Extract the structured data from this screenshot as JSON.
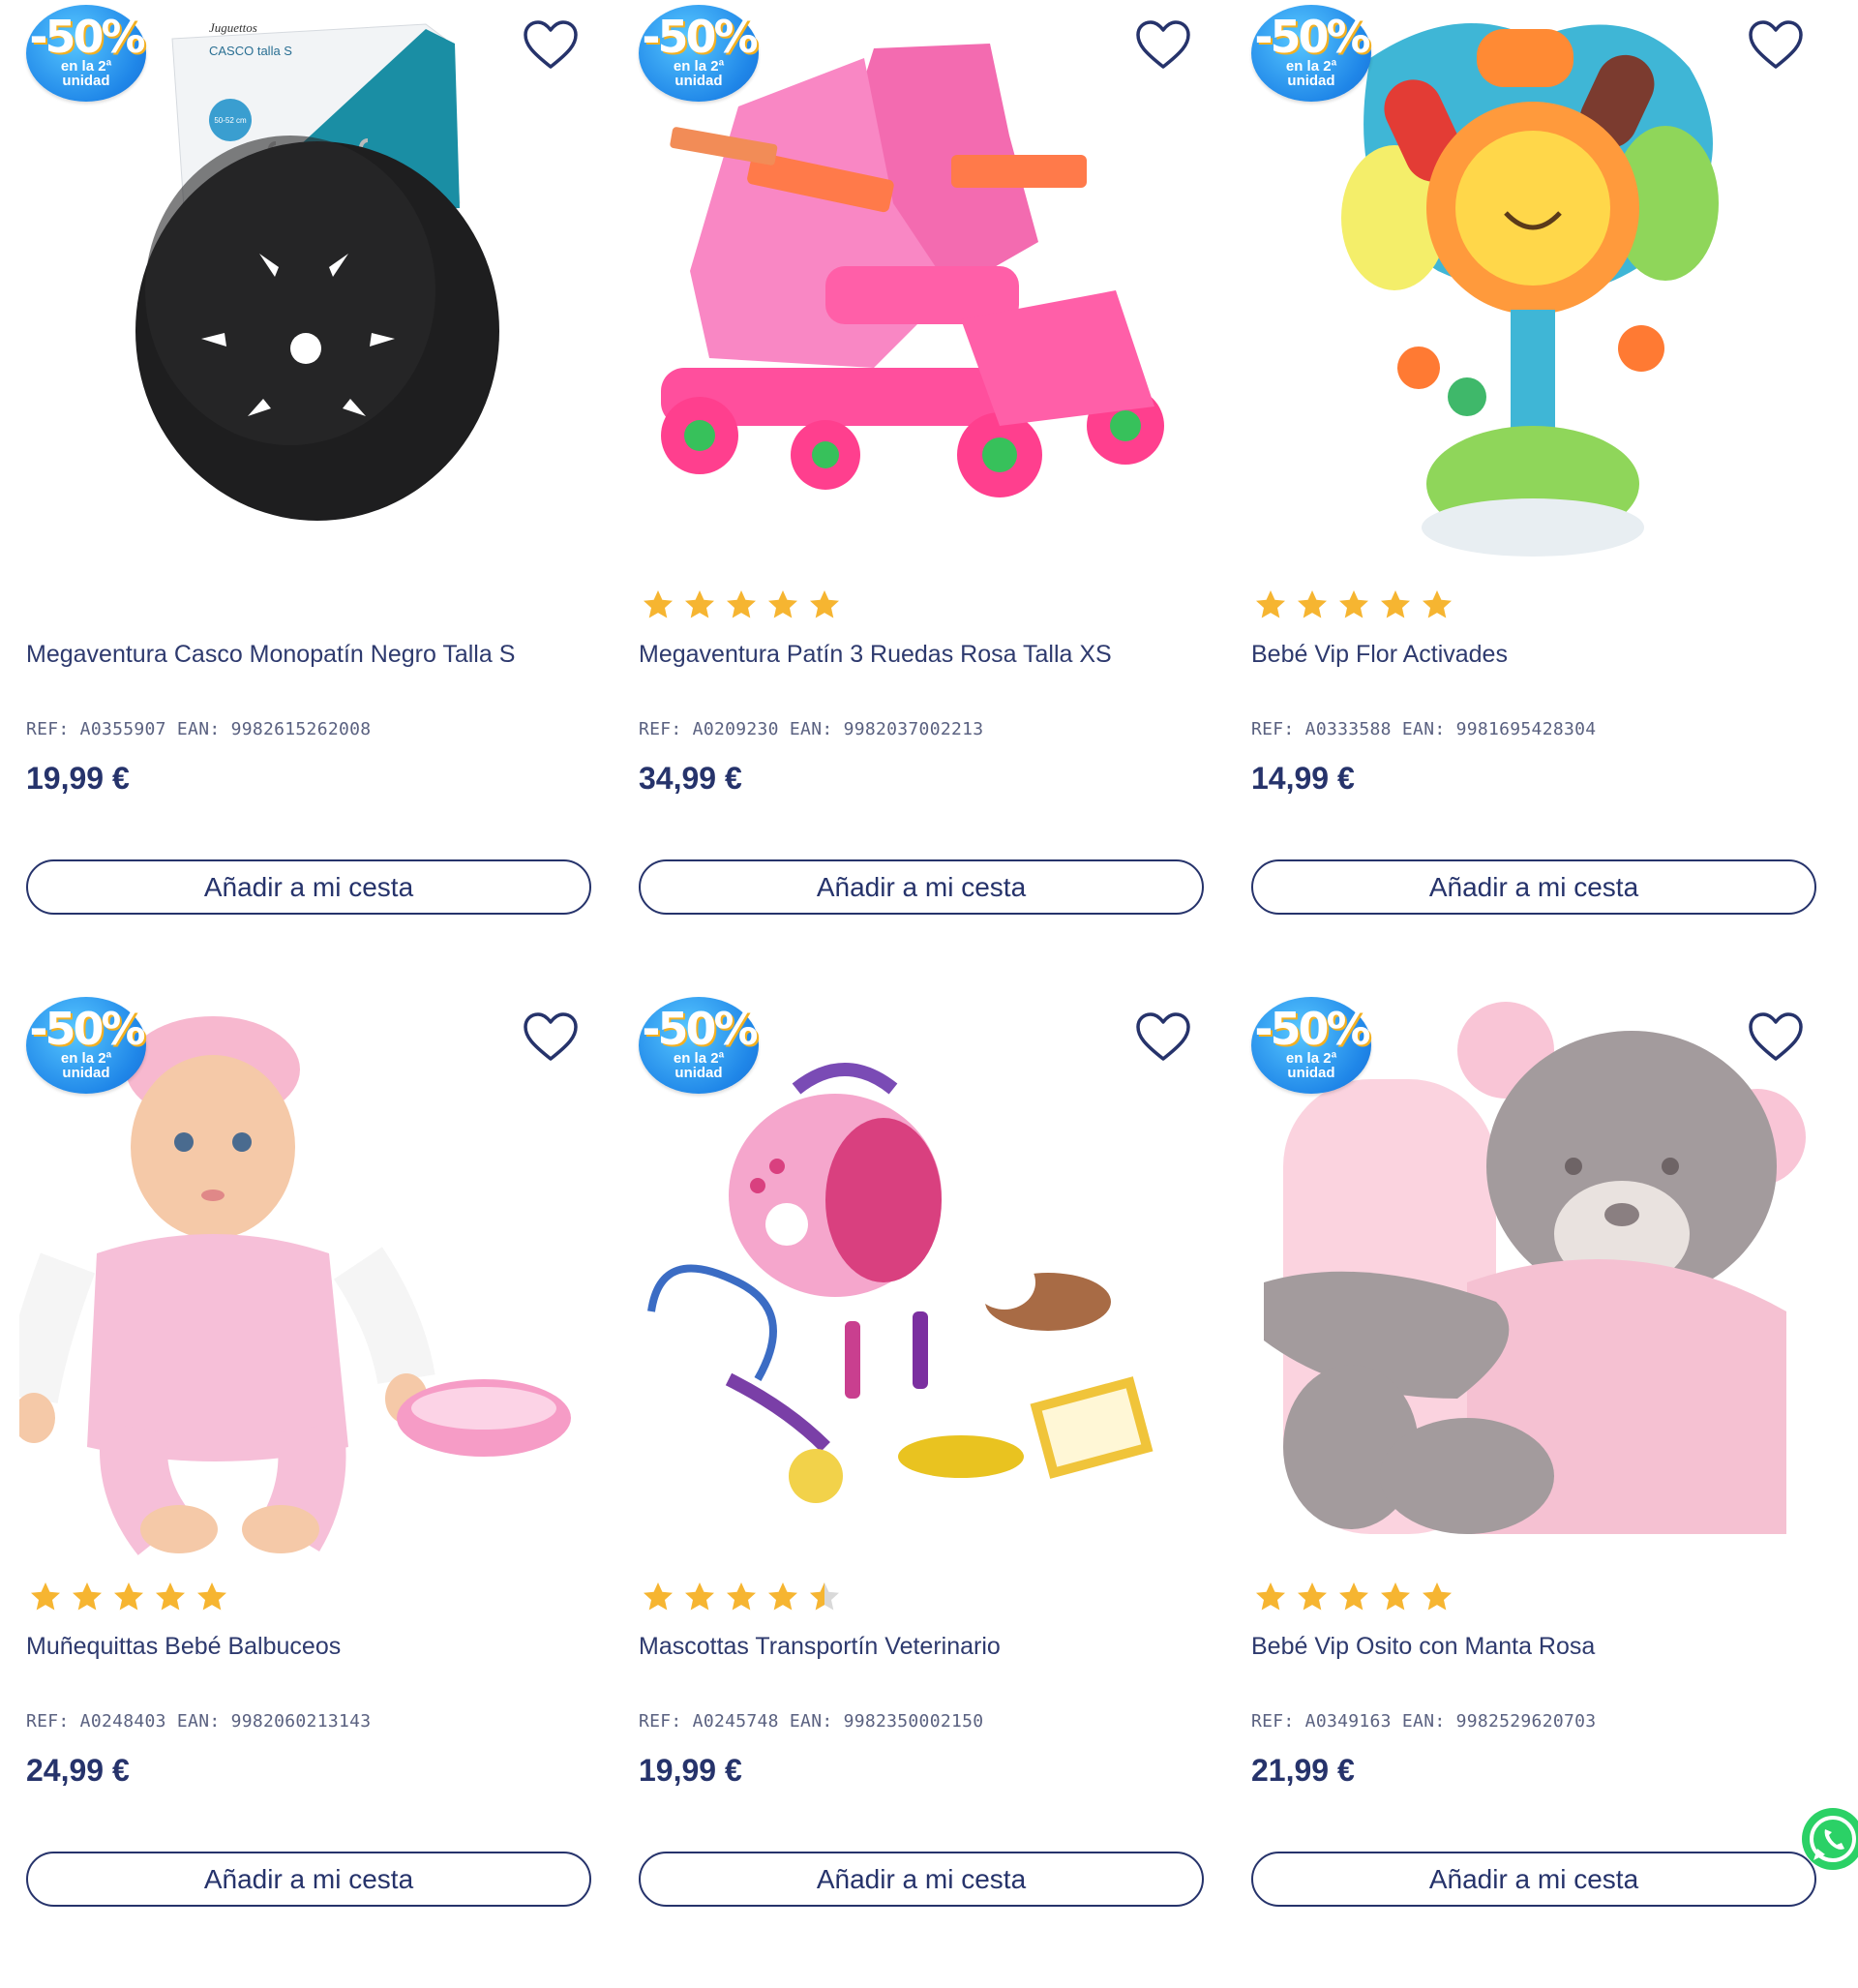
{
  "products": [
    {
      "badge": {
        "discount": "-50%",
        "line1": "en la 2ª",
        "line2": "unidad"
      },
      "image": "helmet-image",
      "rating": null,
      "title": "Megaventura Casco Monopatín Negro Talla S",
      "ref": "REF: A0355907 EAN: 9982615262008",
      "price": "19,99 €",
      "add_label": "Añadir a mi cesta",
      "package_text": [
        "Juguettos",
        "CASCO talla S",
        "50-52 cm"
      ]
    },
    {
      "badge": {
        "discount": "-50%",
        "line1": "en la 2ª",
        "line2": "unidad"
      },
      "image": "roller-skates-image",
      "rating": 5,
      "title": "Megaventura Patín 3 Ruedas Rosa Talla XS",
      "ref": "REF: A0209230 EAN: 9982037002213",
      "price": "34,99 €",
      "add_label": "Añadir a mi cesta"
    },
    {
      "badge": {
        "discount": "-50%",
        "line1": "en la 2ª",
        "line2": "unidad"
      },
      "image": "flower-activity-toy-image",
      "rating": 5,
      "title": "Bebé Vip Flor Activades",
      "ref": "REF: A0333588 EAN: 9981695428304",
      "price": "14,99 €",
      "add_label": "Añadir a mi cesta"
    },
    {
      "badge": {
        "discount": "-50%",
        "line1": "en la 2ª",
        "line2": "unidad"
      },
      "image": "baby-doll-image",
      "rating": 5,
      "title": "Muñequittas Bebé Balbuceos",
      "ref": "REF: A0248403 EAN: 9982060213143",
      "price": "24,99 €",
      "add_label": "Añadir a mi cesta"
    },
    {
      "badge": {
        "discount": "-50%",
        "line1": "en la 2ª",
        "line2": "unidad"
      },
      "image": "vet-carrier-set-image",
      "rating": 4.5,
      "title": "Mascottas Transportín Veterinario",
      "ref": "REF: A0245748 EAN: 9982350002150",
      "price": "19,99 €",
      "add_label": "Añadir a mi cesta"
    },
    {
      "badge": {
        "discount": "-50%",
        "line1": "en la 2ª",
        "line2": "unidad"
      },
      "image": "teddy-bear-blanket-image",
      "rating": 5,
      "title": "Bebé Vip Osito con Manta Rosa",
      "ref": "REF: A0349163 EAN: 9982529620703",
      "price": "21,99 €",
      "add_label": "Añadir a mi cesta"
    }
  ],
  "icons": {
    "favorite": "heart-outline-icon",
    "whatsapp": "whatsapp-icon",
    "star": "star-icon"
  },
  "colors": {
    "primary": "#26336b",
    "star": "#f6b531",
    "badge": "#1f86e8",
    "whatsapp": "#2bd166"
  }
}
